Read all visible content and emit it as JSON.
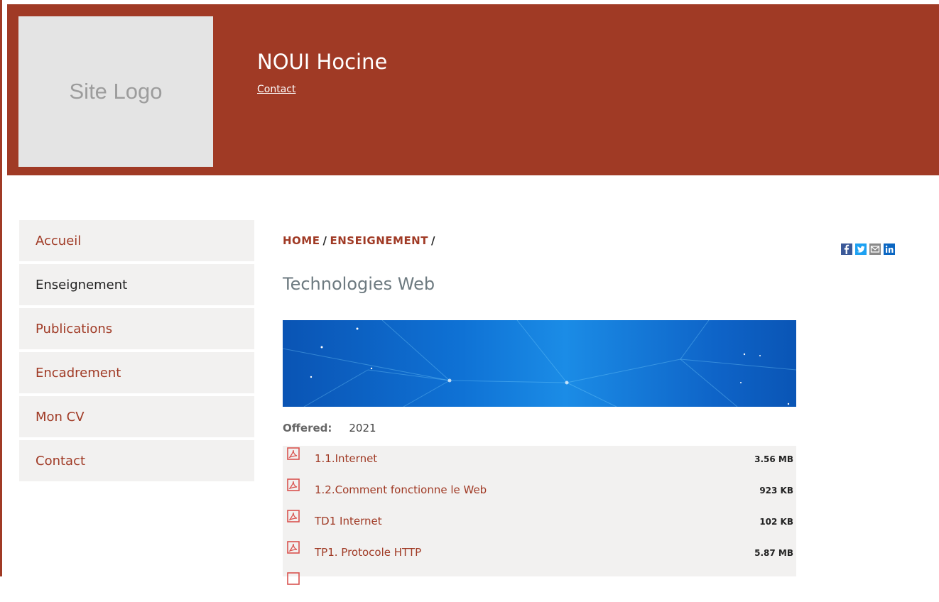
{
  "header": {
    "logo_text": "Site Logo",
    "title": "NOUI Hocine",
    "contact_link": "Contact",
    "bg_color": "#a03a25"
  },
  "sidebar": {
    "items": [
      {
        "label": "Accueil"
      },
      {
        "label": "Enseignement"
      },
      {
        "label": "Publications"
      },
      {
        "label": "Encadrement"
      },
      {
        "label": "Mon CV"
      },
      {
        "label": "Contact"
      }
    ],
    "active": "Enseignement"
  },
  "breadcrumb": {
    "home": "HOME",
    "section": "ENSEIGNEMENT",
    "sep": "/"
  },
  "page": {
    "title": "Technologies Web",
    "offered_label": "Offered:",
    "offered_value": "2021"
  },
  "files": [
    {
      "name": "1.1.Internet",
      "size": "3.56 MB",
      "icon": "pdf-icon"
    },
    {
      "name": "1.2.Comment fonctionne le Web",
      "size": "923 KB",
      "icon": "pdf-icon"
    },
    {
      "name": "TD1 Internet",
      "size": "102 KB",
      "icon": "pdf-icon"
    },
    {
      "name": "TP1. Protocole HTTP",
      "size": "5.87 MB",
      "icon": "pdf-icon"
    }
  ],
  "social": [
    {
      "icon": "facebook-icon",
      "color": "#3b5998"
    },
    {
      "icon": "twitter-icon",
      "color": "#1da1f2"
    },
    {
      "icon": "email-icon",
      "color": "#8a8a8a"
    },
    {
      "icon": "linkedin-icon",
      "color": "#0a66c2"
    }
  ]
}
